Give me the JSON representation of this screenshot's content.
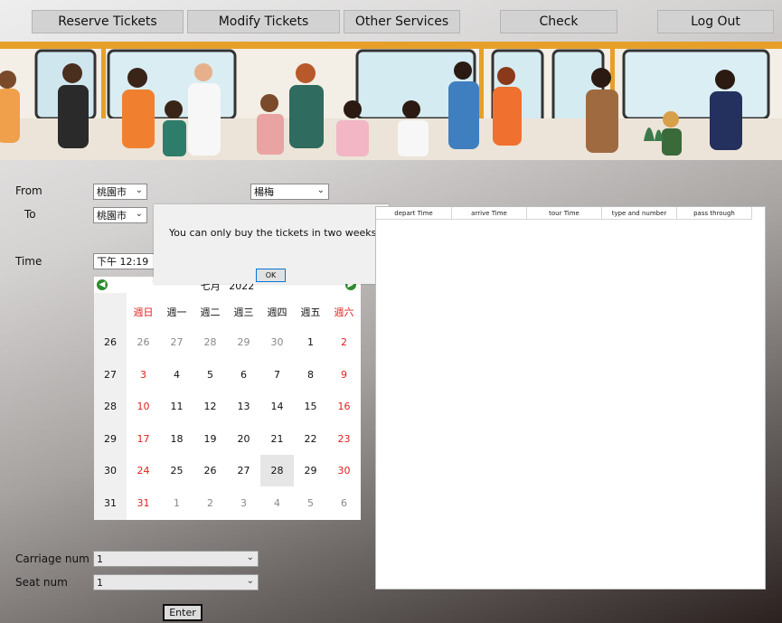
{
  "nav": {
    "reserve": "Reserve Tickets",
    "modify": "Modify Tickets",
    "other": "Other Services",
    "check": "Check",
    "logout": "Log Out"
  },
  "form": {
    "from_label": "From",
    "to_label": "To",
    "time_label": "Time",
    "from_city": "桃園市",
    "from_station": "楊梅",
    "to_city": "桃園市",
    "time_value": "下午 12:19",
    "carriage_label": "Carriage num",
    "carriage_value": "1",
    "seat_label": "Seat num",
    "seat_value": "1",
    "enter": "Enter"
  },
  "popup": {
    "message": "You can only buy the tickets in two weeks",
    "ok": "OK"
  },
  "calendar": {
    "month": "七月",
    "year": "2022",
    "dow": [
      "週日",
      "週一",
      "週二",
      "週三",
      "週四",
      "週五",
      "週六"
    ],
    "weeks": [
      {
        "num": "26",
        "days": [
          "26",
          "27",
          "28",
          "29",
          "30",
          "1",
          "2"
        ]
      },
      {
        "num": "27",
        "days": [
          "3",
          "4",
          "5",
          "6",
          "7",
          "8",
          "9"
        ]
      },
      {
        "num": "28",
        "days": [
          "10",
          "11",
          "12",
          "13",
          "14",
          "15",
          "16"
        ]
      },
      {
        "num": "29",
        "days": [
          "17",
          "18",
          "19",
          "20",
          "21",
          "22",
          "23"
        ]
      },
      {
        "num": "30",
        "days": [
          "24",
          "25",
          "26",
          "27",
          "28",
          "29",
          "30"
        ]
      },
      {
        "num": "31",
        "days": [
          "31",
          "1",
          "2",
          "3",
          "4",
          "5",
          "6"
        ]
      }
    ]
  },
  "results": {
    "columns": [
      "depart Time",
      "arrive Time",
      "tour Time",
      "type and number",
      "pass through"
    ]
  }
}
